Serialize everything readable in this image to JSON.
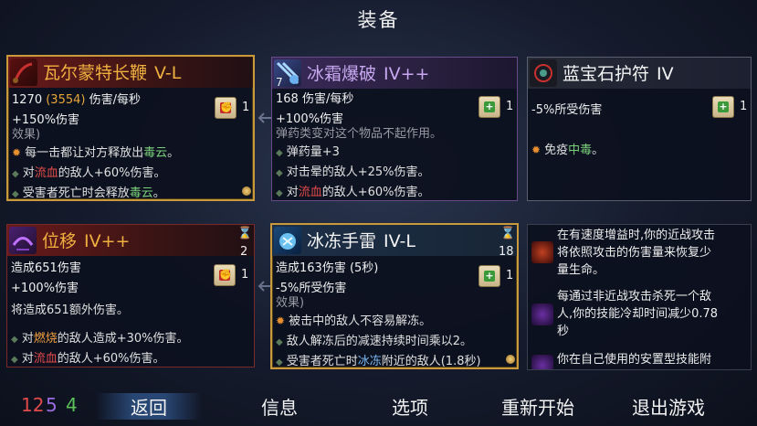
{
  "title": "装备",
  "cards": {
    "whip": {
      "name": "瓦尔蒙特长鞭",
      "tier": "V-L",
      "dps_value": "1270",
      "dps_secondary": "(3554)",
      "dps_unit": "伤害/每秒",
      "bonus": "+150%伤害",
      "scroll_count": "1",
      "cut_text": "效果)",
      "effect1_a": "每一击都让对方释放出",
      "effect1_b": "毒云",
      "effect1_c": "。",
      "effect2_a": "对",
      "effect2_b": "流血",
      "effect2_c": "的敌人+60%伤害。",
      "effect3_a": "受害者死亡时会释放",
      "effect3_b": "毒云",
      "effect3_c": "。"
    },
    "frost": {
      "name": "冰霜爆破",
      "tier": "IV++",
      "icon_count": "7",
      "dps": "168 伤害/每秒",
      "bonus": "+100%伤害",
      "scroll_count": "1",
      "cut_text": "弹药类变对这个物品不起作用。",
      "effect1": "弹药量+3",
      "effect2": "对击晕的敌人+25%伤害。",
      "effect3_a": "对",
      "effect3_b": "流血",
      "effect3_c": "的敌人+60%伤害。"
    },
    "amulet": {
      "name": "蓝宝石护符",
      "tier": "IV",
      "stat": "-5%所受伤害",
      "scroll_count": "1",
      "effect1_a": "免疫",
      "effect1_b": "中毒",
      "effect1_c": "。"
    },
    "displace": {
      "name": "位移",
      "tier": "IV++",
      "cooldown": "2",
      "damage": "造成651伤害",
      "bonus": "+100%伤害",
      "scroll_count": "1",
      "cut_text": "将造成651额外伤害。",
      "effect1_a": "对",
      "effect1_b": "燃烧",
      "effect1_c": "的敌人造成+30%伤害。",
      "effect2_a": "对",
      "effect2_b": "流血",
      "effect2_c": "的敌人+60%伤害。"
    },
    "grenade": {
      "name": "冰冻手雷",
      "tier": "IV-L",
      "cooldown": "18",
      "damage": "造成163伤害 (5秒)",
      "stat": "-5%所受伤害",
      "scroll_count": "1",
      "cut_text": "效果)",
      "effect1": "被击中的敌人不容易解冻。",
      "effect2": "敌人解冻后的减速持续时间乘以2。",
      "effect3_a": "受害者死亡时",
      "effect3_b": "冰冻",
      "effect3_c": "附近的敌人(1.8秒)"
    }
  },
  "side_mutations": [
    {
      "text_1": "在有速度增益时,你的近战攻击",
      "text_2": "将依照攻击的伤害量来恢复少",
      "text_3": "量生命。"
    },
    {
      "text_1": "每通过非近战攻击杀死一个敌",
      "text_2": "人,你的技能冷却时间减少0.78",
      "text_3": "秒"
    },
    {
      "text_1": "你在自己使用的安置型技能附"
    }
  ],
  "bottom": {
    "stat_red": "12",
    "stat_purple": "5",
    "stat_green": "4",
    "menu": [
      "返回",
      "信息",
      "选项",
      "重新开始",
      "退出游戏"
    ]
  },
  "colors": {
    "brutality": "#e04a4a",
    "tactics": "#9a6ae0",
    "survival": "#5ac05a",
    "legendary_border": "#c89a3c"
  },
  "icons": [
    "whip-icon",
    "frost-blast-icon",
    "sapphire-amulet-icon",
    "displacement-icon",
    "ice-grenade-icon",
    "scroll-icon",
    "hourglass-icon"
  ]
}
